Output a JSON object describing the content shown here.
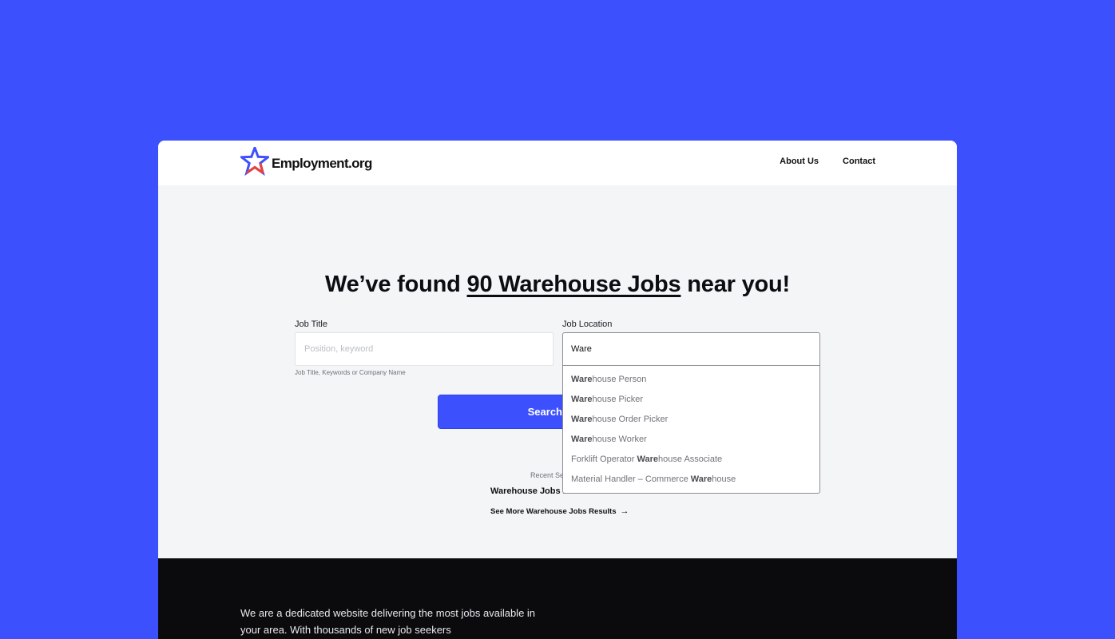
{
  "brand": {
    "name": "Employment.org"
  },
  "nav": {
    "about": "About Us",
    "contact": "Contact"
  },
  "headline": {
    "before": "We’ve found ",
    "highlight": "90 Warehouse Jobs",
    "after": " near you!"
  },
  "job_title": {
    "label": "Job Title",
    "placeholder": "Position, keyword",
    "helper": "Job Title, Keywords or Company Name"
  },
  "job_location": {
    "label": "Job Location",
    "value": "Ware",
    "suggestions": [
      {
        "before": "",
        "match": "Ware",
        "after": "house Person"
      },
      {
        "before": "",
        "match": "Ware",
        "after": "house Picker"
      },
      {
        "before": "",
        "match": "Ware",
        "after": "house Order Picker"
      },
      {
        "before": "",
        "match": "Ware",
        "after": "house Worker"
      },
      {
        "before": "Forklift Operator ",
        "match": "Ware",
        "after": "house Associate"
      },
      {
        "before": "Material Handler – Commerce ",
        "match": "Ware",
        "after": "house"
      }
    ]
  },
  "search": {
    "button": "Search"
  },
  "recent": {
    "label": "Recent Se",
    "link": "Warehouse Jobs i",
    "see_more": "See More Warehouse Jobs Results",
    "arrow": "→"
  },
  "footer": {
    "text": "We are a dedicated website delivering the most jobs available in your area. With thousands of new job seekers"
  },
  "colors": {
    "accent": "#3d50fd",
    "logo_red": "#e8423a",
    "footer_bg": "#0b0b0d"
  }
}
